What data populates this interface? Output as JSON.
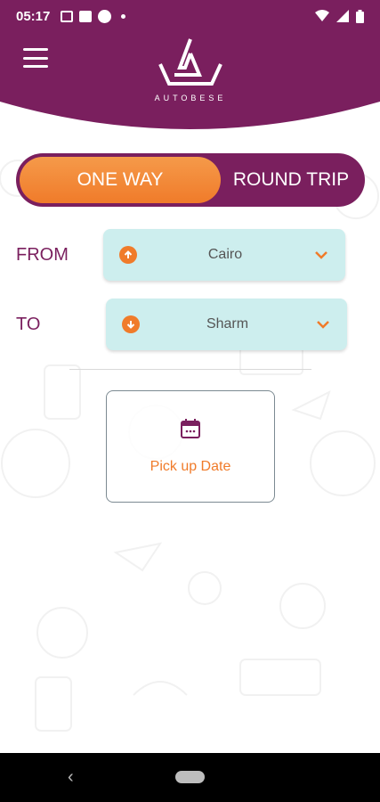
{
  "status_bar": {
    "time": "05:17",
    "icons": [
      "message-icon",
      "facebook-icon",
      "app-icon",
      "dot-icon",
      "wifi-icon",
      "signal-icon",
      "battery-icon"
    ]
  },
  "header": {
    "logo_text": "AUTOBESE",
    "brand_color": "#7a1f5e"
  },
  "trip_toggle": {
    "one_way_label": "ONE WAY",
    "round_trip_label": "ROUND TRIP",
    "selected": "ONE WAY"
  },
  "from": {
    "label": "FROM",
    "value": "Cairo"
  },
  "to": {
    "label": "TO",
    "value": "Sharm"
  },
  "pickup": {
    "label": "Pick up Date"
  },
  "colors": {
    "accent_orange": "#f07b2a",
    "select_bg": "#cdeeee",
    "purple": "#7a1f5e"
  }
}
